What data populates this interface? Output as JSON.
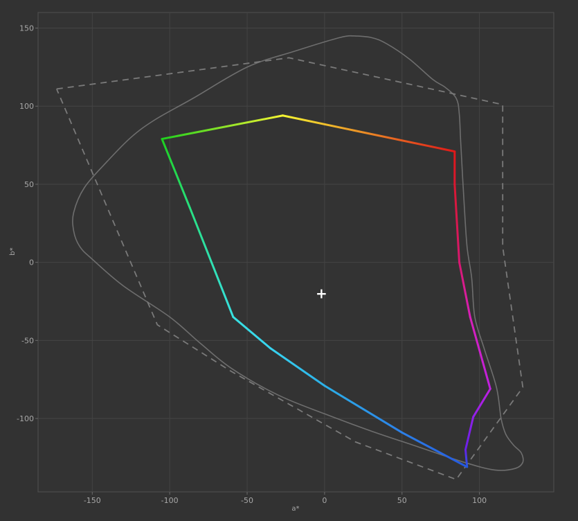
{
  "chart_data": {
    "type": "line",
    "title": "",
    "xlabel": "a*",
    "ylabel": "b*",
    "xlim": [
      -185,
      148
    ],
    "ylim": [
      -147,
      160
    ],
    "xticks": [
      -150,
      -100,
      -50,
      0,
      50,
      100
    ],
    "yticks": [
      150,
      100,
      50,
      0,
      -50,
      -100
    ],
    "grid": true,
    "series": [
      {
        "style": "solid-gray",
        "points": [
          [
            19,
            145
          ],
          [
            10,
            144
          ],
          [
            -20,
            135
          ],
          [
            -50,
            125
          ],
          [
            -85,
            105
          ],
          [
            -110,
            91
          ],
          [
            -125,
            80
          ],
          [
            -140,
            65
          ],
          [
            -155,
            48
          ],
          [
            -162,
            32
          ],
          [
            -162,
            20
          ],
          [
            -158,
            10
          ],
          [
            -150,
            2
          ],
          [
            -130,
            -15
          ],
          [
            -100,
            -35
          ],
          [
            -80,
            -52
          ],
          [
            -60,
            -68
          ],
          [
            -30,
            -85
          ],
          [
            0,
            -97
          ],
          [
            30,
            -108
          ],
          [
            60,
            -118
          ],
          [
            90,
            -128
          ],
          [
            110,
            -133
          ],
          [
            123,
            -132
          ],
          [
            128,
            -128
          ],
          [
            127,
            -122
          ],
          [
            122,
            -117
          ],
          [
            117,
            -110
          ],
          [
            114,
            -100
          ],
          [
            111,
            -80
          ],
          [
            103,
            -55
          ],
          [
            97,
            -35
          ],
          [
            95,
            -10
          ],
          [
            92,
            10
          ],
          [
            90,
            40
          ],
          [
            88,
            75
          ],
          [
            87,
            95
          ],
          [
            85,
            105
          ],
          [
            78,
            112
          ],
          [
            70,
            117
          ],
          [
            55,
            130
          ],
          [
            40,
            140
          ],
          [
            30,
            144
          ],
          [
            19,
            145
          ]
        ]
      },
      {
        "style": "dashed-gray",
        "points": [
          [
            -173,
            111
          ],
          [
            -23,
            131
          ],
          [
            115,
            101
          ],
          [
            115,
            10
          ],
          [
            128,
            -80
          ],
          [
            85,
            -139
          ],
          [
            20,
            -115
          ],
          [
            -60,
            -70
          ],
          [
            -108,
            -40
          ],
          [
            -173,
            111
          ]
        ]
      },
      {
        "style": "rainbow-gamut",
        "points": [
          [
            -105,
            79
          ],
          [
            -27,
            94
          ],
          [
            84,
            71
          ],
          [
            84,
            50
          ],
          [
            87,
            0
          ],
          [
            94,
            -35
          ],
          [
            107,
            -81
          ],
          [
            96,
            -99
          ],
          [
            91,
            -120
          ],
          [
            92,
            -131
          ],
          [
            50,
            -109
          ],
          [
            0,
            -79
          ],
          [
            -35,
            -55
          ],
          [
            -59,
            -35
          ],
          [
            -87,
            35
          ],
          [
            -105,
            79
          ]
        ],
        "colors": [
          "#1ed01e",
          "#f5f532",
          "#e01818",
          "#d81830",
          "#d81870",
          "#d820b8",
          "#c020e0",
          "#9020e8",
          "#6820e8",
          "#2458e0",
          "#2c80e8",
          "#2cb0e8",
          "#38d4f0",
          "#38e0e0",
          "#28e080",
          "#1ed01e"
        ]
      }
    ],
    "marker": {
      "symbol": "+",
      "x": -2,
      "y": -20
    }
  }
}
